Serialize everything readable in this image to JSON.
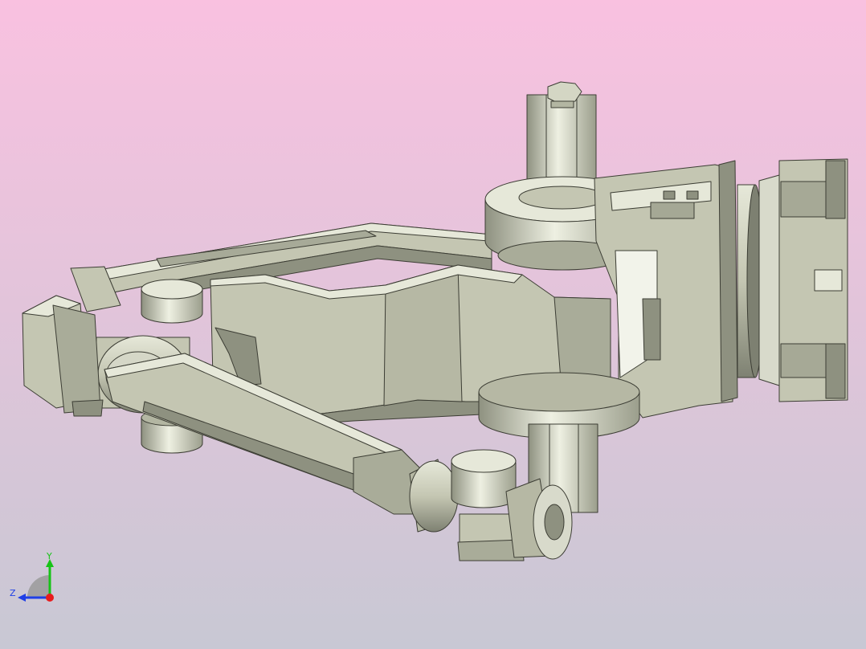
{
  "viewport": {
    "background_top": "#f9c1e0",
    "background_bottom": "#c8c8d4"
  },
  "model": {
    "body_color": "#c4c6b2",
    "shade_color": "#8e9180",
    "light_color": "#e6e8d9",
    "edge_color": "#3c3d34"
  },
  "triad": {
    "x_color": "#e81c1c",
    "y_color": "#16c316",
    "z_color": "#1f3fe6",
    "y_label": "Y",
    "z_label": "Z"
  }
}
